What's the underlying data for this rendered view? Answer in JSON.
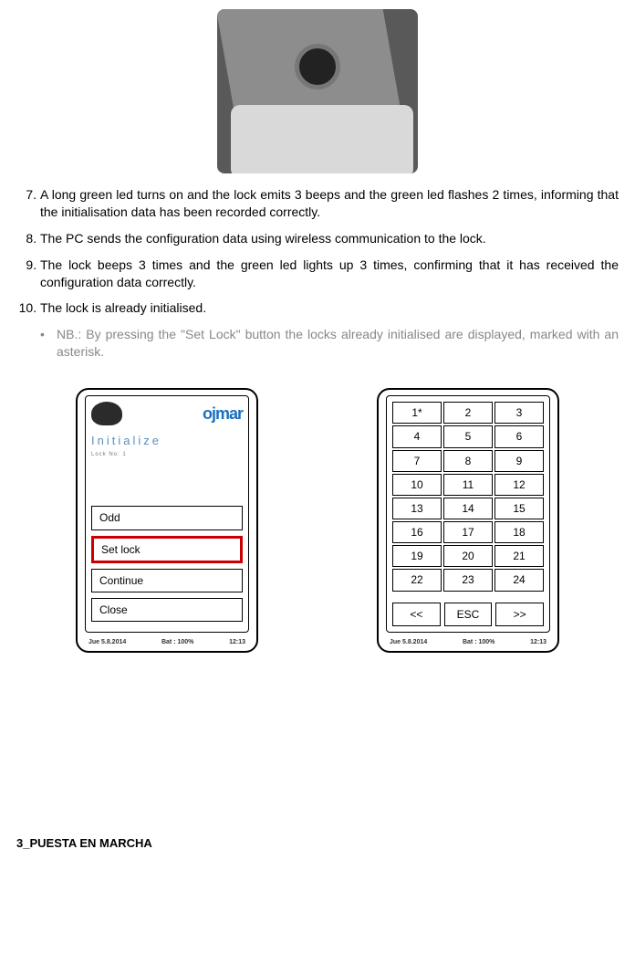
{
  "steps": {
    "s7": "A long green led turns on and the lock emits 3 beeps and the green led flashes 2 times, informing that the initialisation data has been recorded correctly.",
    "s8": "The PC sends the configuration data using wireless communication to the lock.",
    "s9": "The lock beeps 3 times and the green led lights up 3 times, confirming that it has received the configuration data correctly.",
    "s10": "The lock is already initialised."
  },
  "note": "NB.: By pressing the \"Set Lock\" button the locks already initialised are displayed, marked with an asterisk.",
  "deviceA": {
    "brand": "ojmar",
    "title": "Initialize",
    "subtitle": "Lock No: 1",
    "options": {
      "odd": "Odd",
      "setlock": "Set lock",
      "continue": "Continue",
      "close": "Close"
    }
  },
  "deviceB": {
    "cells": [
      "1*",
      "2",
      "3",
      "4",
      "5",
      "6",
      "7",
      "8",
      "9",
      "10",
      "11",
      "12",
      "13",
      "14",
      "15",
      "16",
      "17",
      "18",
      "19",
      "20",
      "21",
      "22",
      "23",
      "24"
    ],
    "nav": {
      "prev": "<<",
      "esc": "ESC",
      "next": ">>"
    }
  },
  "status": {
    "date": "Jue 5.8.2014",
    "bat": "Bat :  100%",
    "time": "12:13"
  },
  "footer": "3_PUESTA EN MARCHA"
}
